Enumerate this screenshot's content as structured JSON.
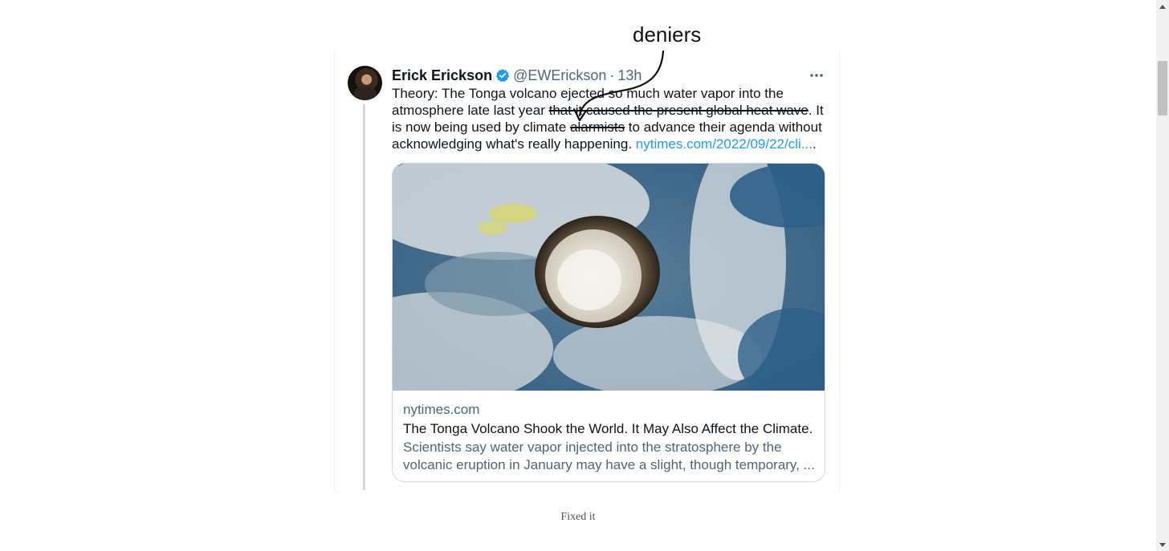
{
  "annotation": {
    "label": "deniers"
  },
  "tweet": {
    "author_name": "Erick Erickson",
    "handle": "@EWErickson",
    "separator": "·",
    "time": "13h",
    "more_icon": "ellipsis-icon",
    "verified_icon": "verified-badge-icon",
    "text_part1": "Theory: The Tonga volcano ejected so much water vapor into the atmosphere late last year ",
    "text_struck1": "that it caused the present global heat wave",
    "text_part2": ".  It is now being used by climate ",
    "text_struck2": "alarmists",
    "text_part3": " to advance their agenda without acknowledging what's really happening. ",
    "link_text": "nytimes.com/2022/09/22/cli...",
    "text_end": ".",
    "colors": {
      "link": "#1d9bf0",
      "verified": "#1d9bf0",
      "muted": "#536471"
    }
  },
  "card": {
    "image_alt": "satellite view of volcanic eruption",
    "domain": "nytimes.com",
    "title": "The Tonga Volcano Shook the World. It May Also Affect the Climate.",
    "description": "Scientists say water vapor injected into the stratosphere by the volcanic eruption in January may have a slight, though temporary, ..."
  },
  "caption": "Fixed it"
}
